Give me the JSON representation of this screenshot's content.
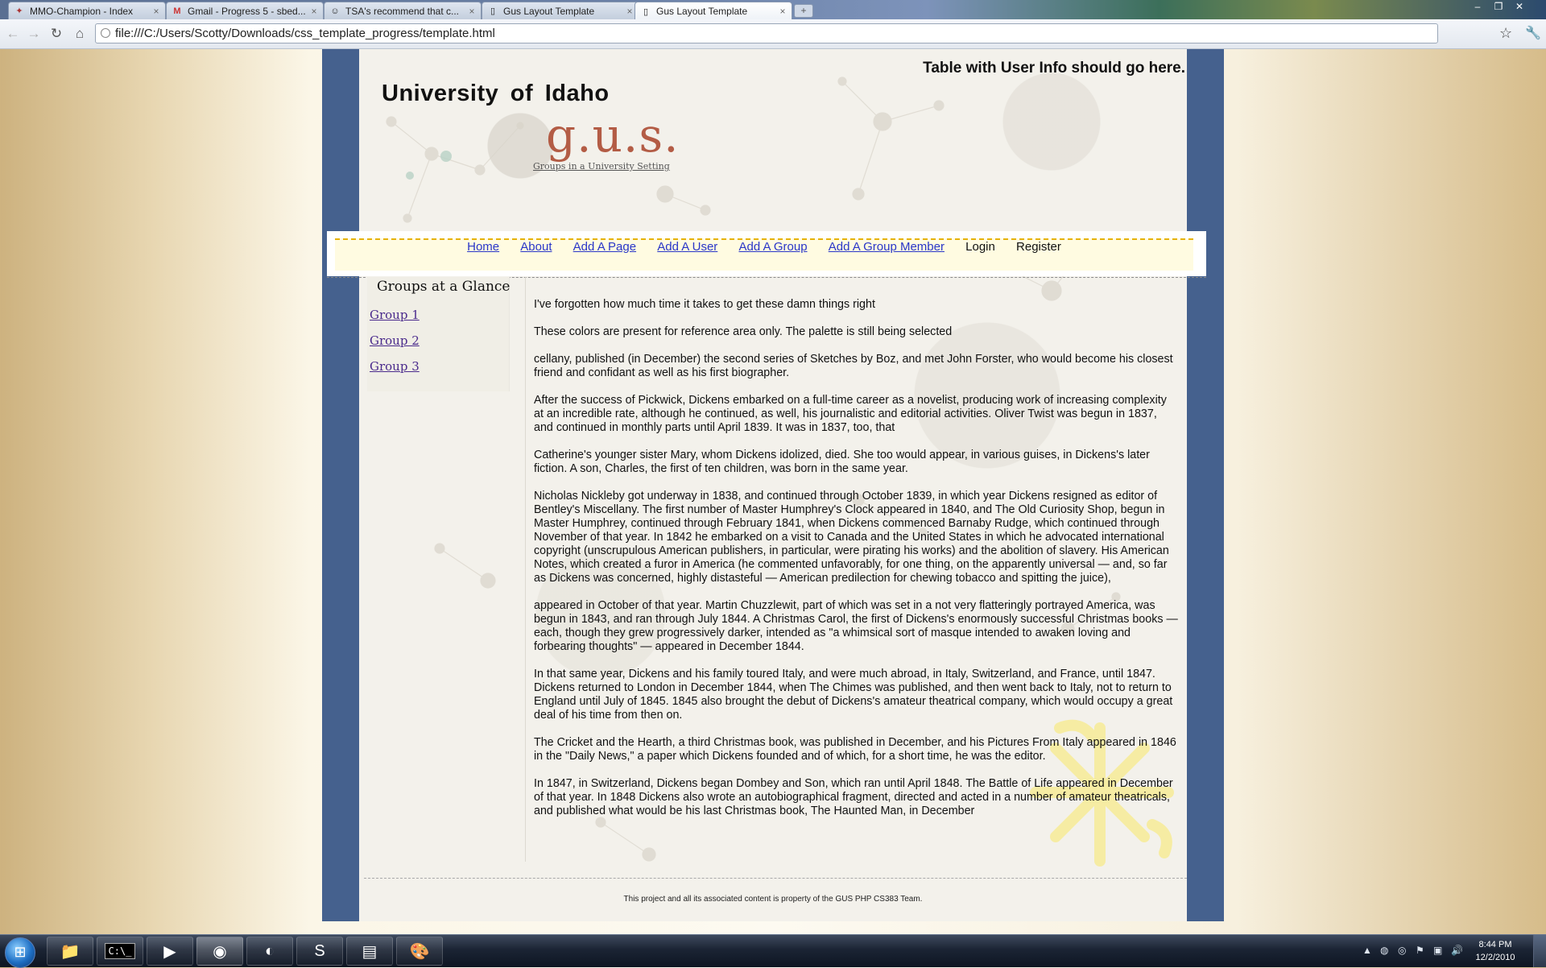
{
  "browser": {
    "tabs": [
      {
        "title": "MMO-Champion - Index",
        "icon": "mmo-icon"
      },
      {
        "title": "Gmail - Progress 5 - sbed...",
        "icon": "gmail-icon"
      },
      {
        "title": "TSA's recommend that c...",
        "icon": "reddit-icon"
      },
      {
        "title": "Gus Layout Template",
        "icon": "page-icon"
      },
      {
        "title": "Gus Layout Template",
        "icon": "page-icon"
      }
    ],
    "active_tab_index": 4,
    "url": "file:///C:/Users/Scotty/Downloads/css_template_progress/template.html"
  },
  "site": {
    "university": "University  of  Idaho",
    "logo": "g.u.s.",
    "logo_subtitle": "Groups in a University Setting",
    "user_info_notice": "Table with User Info should go here."
  },
  "nav": {
    "links": [
      {
        "label": "Home",
        "link": true
      },
      {
        "label": "About",
        "link": true
      },
      {
        "label": "Add A Page",
        "link": true
      },
      {
        "label": "Add A User",
        "link": true
      },
      {
        "label": "Add A Group",
        "link": true
      },
      {
        "label": "Add A Group Member",
        "link": true
      },
      {
        "label": "Login",
        "link": false
      },
      {
        "label": "Register",
        "link": false
      }
    ]
  },
  "sidebar": {
    "title": "Groups at a Glance",
    "groups": [
      "Group 1",
      "Group 2",
      "Group 3"
    ]
  },
  "content": {
    "paragraphs": [
      "I've forgotten how much time it takes to get these damn things right",
      "These colors are present for reference area only. The palette is still being selected",
      "cellany, published (in December) the second series of Sketches by Boz, and met John Forster, who would become his closest friend and confidant as well as his first biographer.",
      "After the success of Pickwick, Dickens embarked on a full-time career as a novelist, producing work of increasing complexity at an incredible rate, although he continued, as well, his journalistic and editorial activities. Oliver Twist was begun in 1837, and continued in monthly parts until April 1839. It was in 1837, too, that",
      "Catherine's younger sister Mary, whom Dickens idolized, died. She too would appear, in various guises, in Dickens's later fiction. A son, Charles, the first of ten children, was born in the same year.",
      "Nicholas Nickleby got underway in 1838, and continued through October 1839, in which year Dickens resigned as editor of Bentley's Miscellany. The first number of Master Humphrey's Clock appeared in 1840, and The Old Curiosity Shop, begun in Master Humphrey, continued through February 1841, when Dickens commenced Barnaby Rudge, which continued through November of that year. In 1842 he embarked on a visit to Canada and the United States in which he advocated international copyright (unscrupulous American publishers, in particular, were pirating his works) and the abolition of slavery. His American Notes, which created a furor in America (he commented unfavorably, for one thing, on the apparently universal — and, so far as Dickens was concerned, highly distasteful — American predilection for chewing tobacco and spitting the juice),",
      "appeared in October of that year. Martin Chuzzlewit, part of which was set in a not very flatteringly portrayed America, was begun in 1843, and ran through July 1844. A Christmas Carol, the first of Dickens's enormously successful Christmas books — each, though they grew progressively darker, intended as \"a whimsical sort of masque intended to awaken loving and forbearing thoughts\" — appeared in December 1844.",
      "In that same year, Dickens and his family toured Italy, and were much abroad, in Italy, Switzerland, and France, until 1847. Dickens returned to London in December 1844, when The Chimes was published, and then went back to Italy, not to return to England until July of 1845. 1845 also brought the debut of Dickens's amateur theatrical company, which would occupy a great deal of his time from then on.",
      "The Cricket and the Hearth, a third Christmas book, was published in December, and his Pictures From Italy appeared in 1846 in the \"Daily News,\" a paper which Dickens founded and of which, for a short time, he was the editor.",
      "In 1847, in Switzerland, Dickens began Dombey and Son, which ran until April 1848. The Battle of Life appeared in December of that year. In 1848 Dickens also wrote an autobiographical fragment, directed and acted in a number of amateur theatricals, and published what would be his last Christmas book, The Haunted Man, in December"
    ]
  },
  "footer": {
    "text": "This project and all its associated content is property of the GUS PHP CS383 Team."
  },
  "taskbar": {
    "apps": [
      "explorer-icon",
      "cmd-icon",
      "media-player-icon",
      "chrome-icon",
      "eclipse-icon",
      "skype-icon",
      "notepad-icon",
      "paint-icon"
    ],
    "active_app_index": 3,
    "clock_time": "8:44 PM",
    "clock_date": "12/2/2010"
  },
  "colors": {
    "frame": "#45618e",
    "logo": "#b35c45",
    "nav_link": "#2a36c8",
    "nav_strip": "#fffbe1",
    "nav_dash": "#e6b200",
    "visited_link": "#4a2a8c"
  }
}
